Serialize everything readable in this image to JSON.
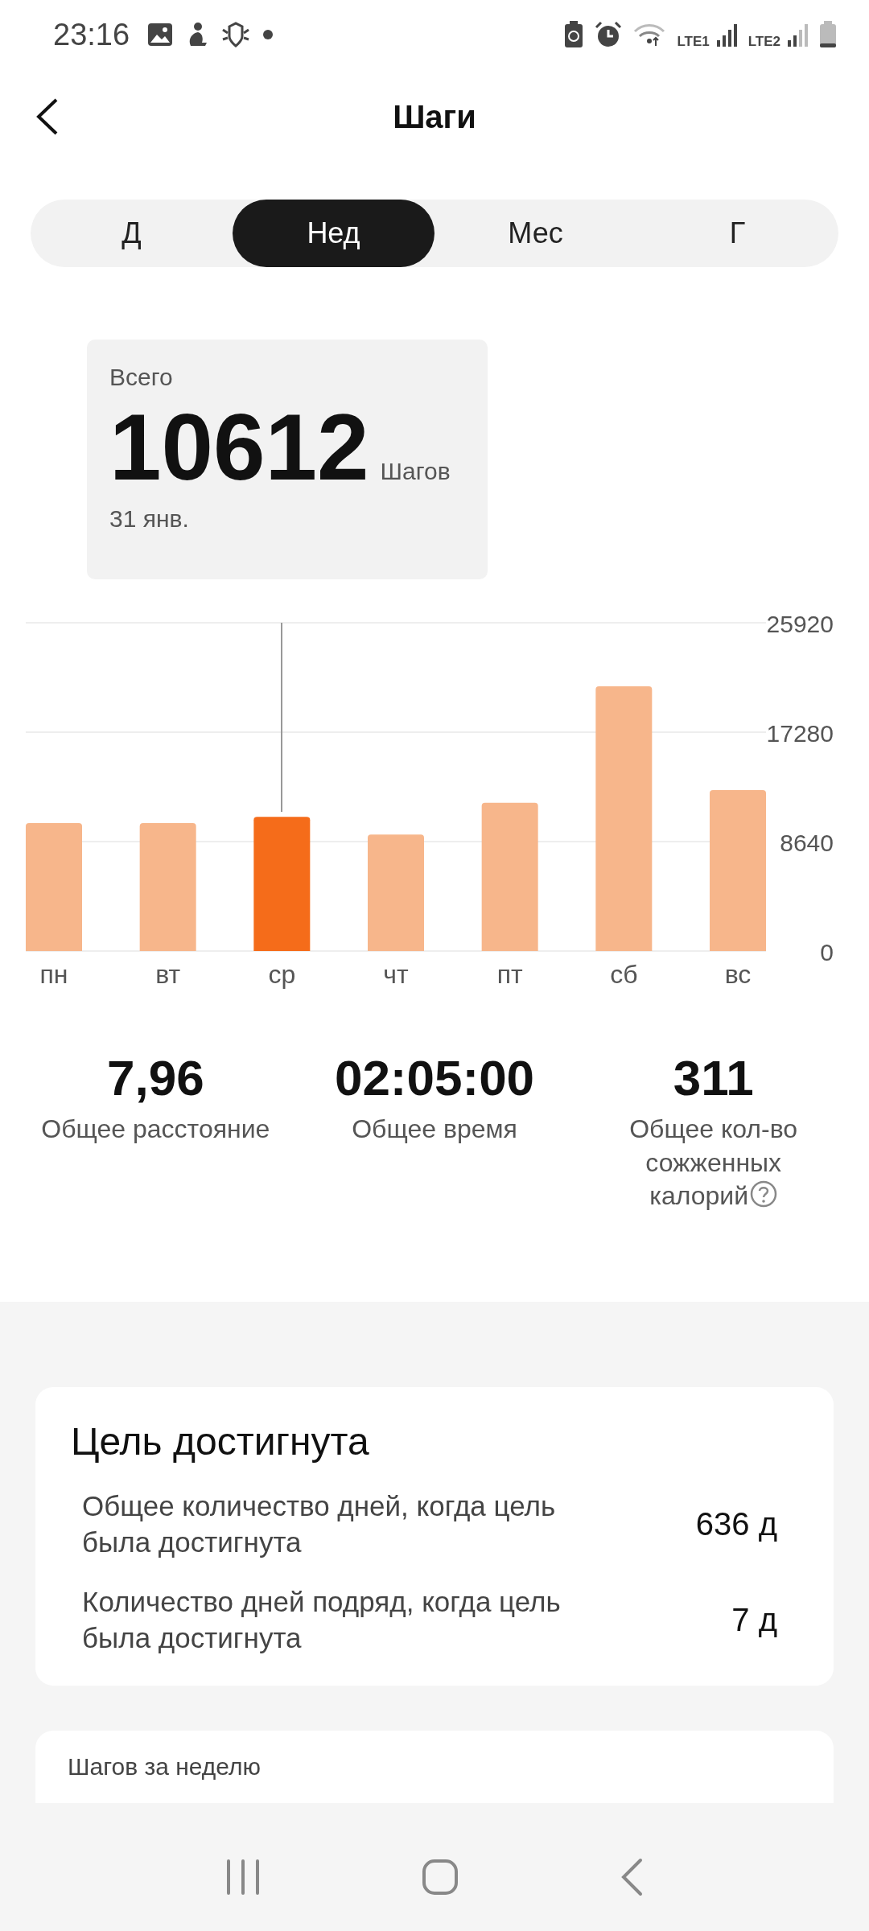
{
  "status_bar": {
    "time": "23:16",
    "sim1": "LTE1",
    "sim2": "LTE2"
  },
  "header": {
    "title": "Шаги"
  },
  "tabs": [
    {
      "label": "Д",
      "selected": false
    },
    {
      "label": "Нед",
      "selected": true
    },
    {
      "label": "Мес",
      "selected": false
    },
    {
      "label": "Г",
      "selected": false
    }
  ],
  "summary": {
    "label": "Всего",
    "value": "10612",
    "unit": "Шагов",
    "date": "31 янв."
  },
  "chart_data": {
    "type": "bar",
    "categories": [
      "пн",
      "вт",
      "ср",
      "чт",
      "пт",
      "сб",
      "вс"
    ],
    "ylim": [
      0,
      25920
    ],
    "yticks": [
      0,
      8640,
      17280,
      25920
    ],
    "series": [
      {
        "color": "#f7b68b",
        "values": [
          10100,
          10100,
          null,
          9200,
          11700,
          20900,
          12700
        ]
      },
      {
        "color": "#f56c1a",
        "values": [
          null,
          null,
          10600,
          null,
          null,
          null,
          null
        ]
      }
    ]
  },
  "stats": [
    {
      "value": "7,96",
      "label": "Общее расстояние",
      "help": false
    },
    {
      "value": "02:05:00",
      "label": "Общее время",
      "help": false
    },
    {
      "value": "311",
      "label": "Общее кол-во сожженных калорий",
      "help": true
    }
  ],
  "goal_card": {
    "title": "Цель достигнута",
    "rows": [
      {
        "label": "Общее количество дней, когда цель была достигнута",
        "value": "636 д"
      },
      {
        "label": "Количество дней подряд, когда цель была достигнута",
        "value": "7 д"
      }
    ]
  },
  "next_card": {
    "title": "Шагов за неделю"
  }
}
